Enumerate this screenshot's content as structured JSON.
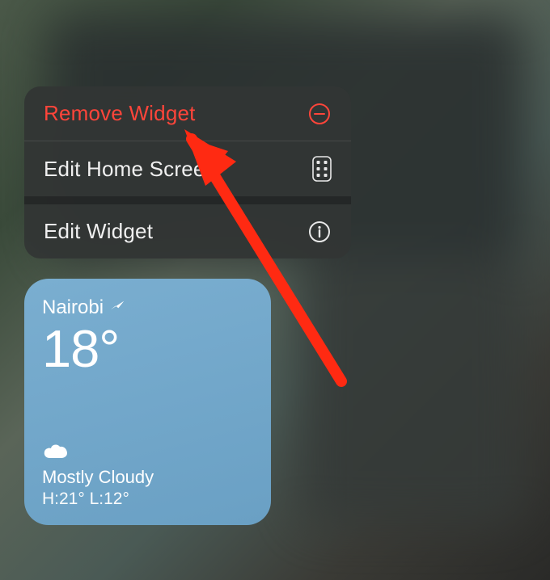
{
  "menu": {
    "remove_label": "Remove Widget",
    "edit_home_label": "Edit Home Screen",
    "edit_widget_label": "Edit Widget"
  },
  "weather": {
    "location": "Nairobi",
    "temperature": "18°",
    "condition": "Mostly Cloudy",
    "hi_lo": "H:21° L:12°"
  },
  "colors": {
    "destructive": "#ff453a",
    "widget_bg": "#6fa4c8"
  }
}
